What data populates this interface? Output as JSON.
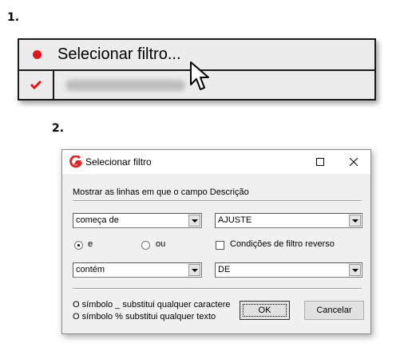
{
  "steps": {
    "one": "1.",
    "two": "2."
  },
  "menu": {
    "item_label": "Selecionar filtro...",
    "item_bullet_color": "#e8141b",
    "second_item_icon": "check-icon",
    "second_item_icon_color": "#e8141b"
  },
  "dialog": {
    "title": "Selecionar filtro",
    "app_icon": "app-logo-icon",
    "description_label": "Mostrar as linhas em que o campo Descrição",
    "row1": {
      "operator": "começa de",
      "value": "AJUSTE"
    },
    "logic": {
      "option_and": "e",
      "option_or": "ou",
      "selected": "e"
    },
    "reverse_label": "Condições de filtro reverso",
    "reverse_checked": false,
    "row2": {
      "operator": "contém",
      "value": "DE"
    },
    "hint1": "O símbolo _ substitui qualquer caractere",
    "hint2": "O símbolo % substitui qualquer texto",
    "ok_label": "OK",
    "cancel_label": "Cancelar"
  }
}
